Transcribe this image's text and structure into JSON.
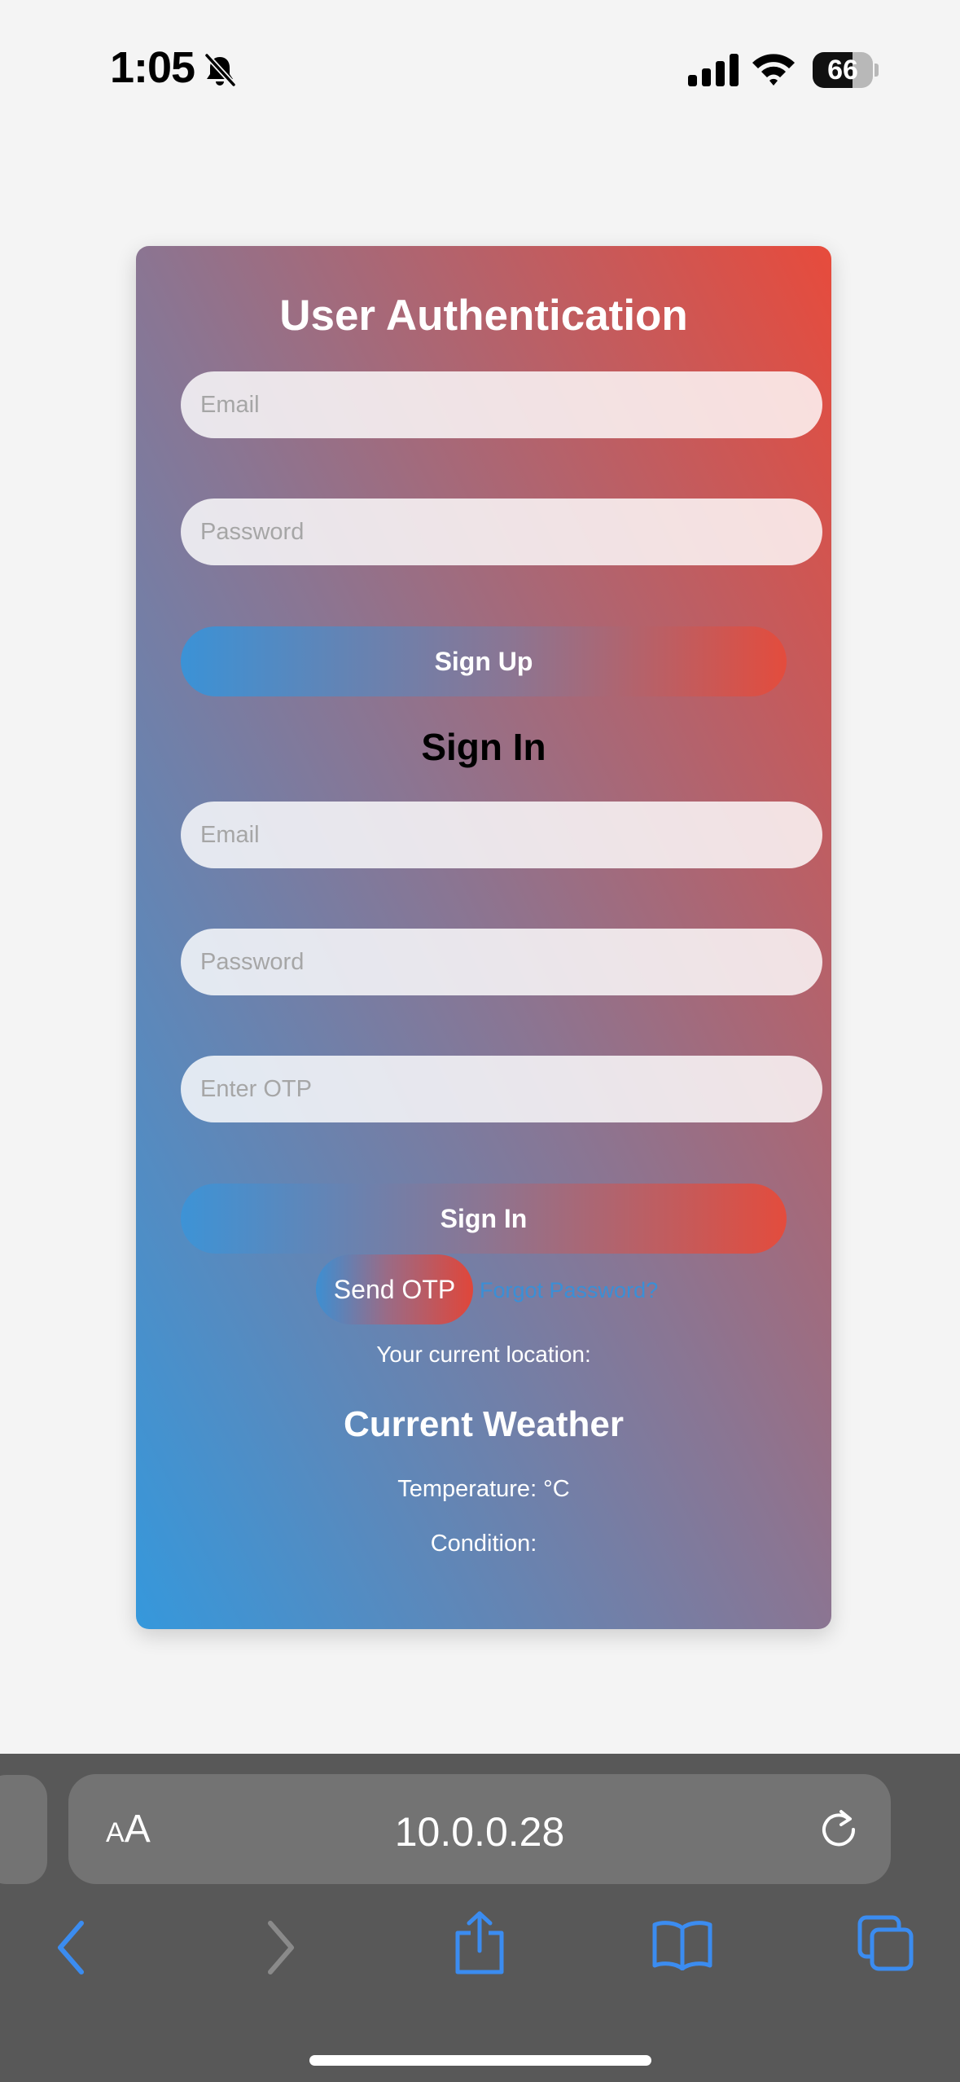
{
  "status_bar": {
    "time": "1:05",
    "battery_label": "66",
    "battery_level": 0.66,
    "icons": [
      "bell-slash-icon",
      "cellular-signal-icon",
      "wifi-icon",
      "battery-icon"
    ]
  },
  "auth": {
    "title": "User Authentication",
    "signup": {
      "email_placeholder": "Email",
      "password_placeholder": "Password",
      "button_label": "Sign Up"
    },
    "signin": {
      "heading": "Sign In",
      "email_placeholder": "Email",
      "password_placeholder": "Password",
      "otp_placeholder": "Enter OTP",
      "button_label": "Sign In",
      "send_otp_label": "Send OTP",
      "forgot_password_label": "Forgot Password?"
    },
    "location_text": "Your current location:",
    "weather": {
      "title": "Current Weather",
      "temperature": "Temperature: °C",
      "condition": "Condition:"
    }
  },
  "browser": {
    "text_size_small": "A",
    "text_size_large": "A",
    "url": "10.0.0.28",
    "toolbar_icons": [
      "back-icon",
      "forward-icon",
      "share-icon",
      "bookmarks-icon",
      "tabs-icon"
    ]
  },
  "colors": {
    "card_gradient_start": "#3598dc",
    "card_gradient_end": "#e74b3c",
    "link": "#3a8fd6",
    "safari_accent": "#3b8cf0",
    "browser_bar": "#585858"
  }
}
